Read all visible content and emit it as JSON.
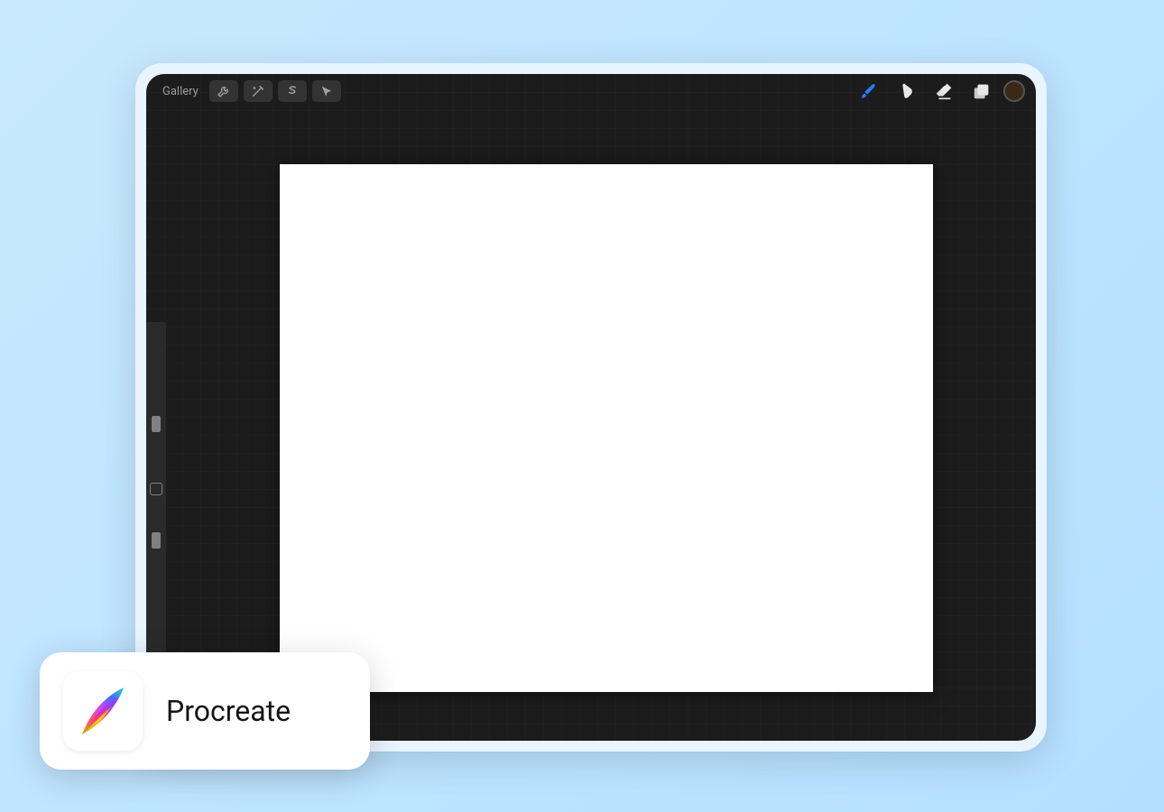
{
  "toolbar": {
    "gallery_label": "Gallery",
    "left_tools": [
      {
        "name": "actions-icon"
      },
      {
        "name": "adjustments-icon"
      },
      {
        "name": "selection-icon"
      },
      {
        "name": "transform-icon"
      }
    ],
    "right_tools": [
      {
        "name": "brush-icon",
        "active": true
      },
      {
        "name": "smudge-icon"
      },
      {
        "name": "eraser-icon"
      },
      {
        "name": "layers-icon"
      }
    ],
    "active_color": "#3a2a15"
  },
  "sidebar": {
    "brush_size_percent": 60,
    "brush_opacity_percent": 20
  },
  "canvas": {
    "background": "#ffffff"
  },
  "badge": {
    "app_name": "Procreate"
  },
  "colors": {
    "accent_blue": "#1f7fff"
  }
}
